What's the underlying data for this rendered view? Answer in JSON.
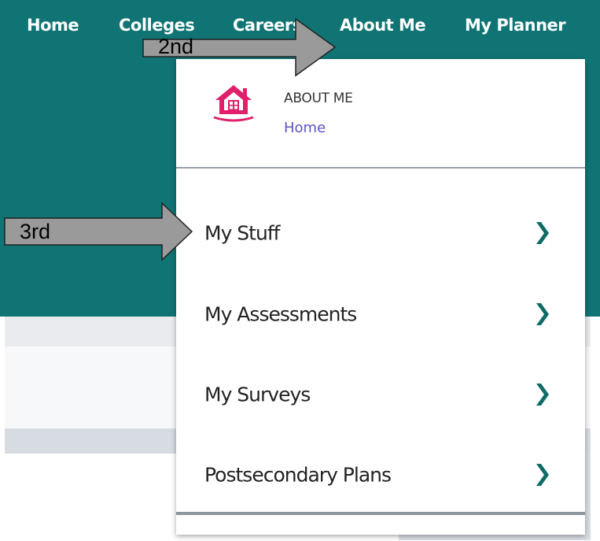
{
  "nav": {
    "items": [
      {
        "label": "Home"
      },
      {
        "label": "Colleges"
      },
      {
        "label": "Careers"
      },
      {
        "label": "About Me"
      },
      {
        "label": "My Planner"
      }
    ]
  },
  "menu": {
    "title": "ABOUT ME",
    "home_link": "Home",
    "items": [
      {
        "label": "My Stuff"
      },
      {
        "label": "My Assessments"
      },
      {
        "label": "My Surveys"
      },
      {
        "label": "Postsecondary Plans"
      }
    ]
  },
  "annotations": {
    "second": "2nd",
    "third": "3rd"
  },
  "colors": {
    "header_teal": "#0f7473",
    "chevron": "#0f6b67",
    "home_icon": "#e0206b",
    "link": "#5b53c6"
  },
  "icons": {
    "menu_header": "house-icon",
    "menu_item": "chevron-right-icon"
  }
}
